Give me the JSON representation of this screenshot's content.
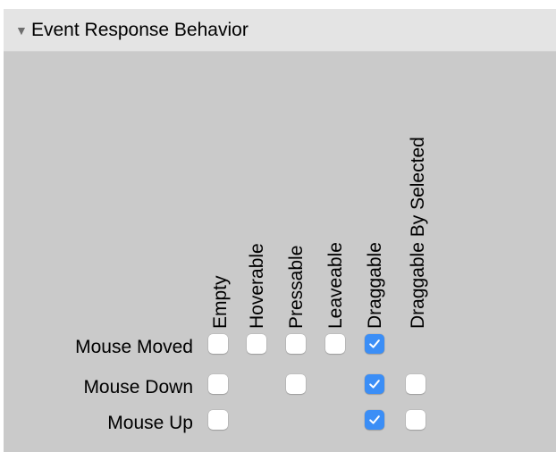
{
  "panel": {
    "disclosure_icon": "▼",
    "title": "Event Response Behavior"
  },
  "columns": [
    {
      "label": "Empty"
    },
    {
      "label": "Hoverable"
    },
    {
      "label": "Pressable"
    },
    {
      "label": "Leaveable"
    },
    {
      "label": "Draggable"
    },
    {
      "label": "Draggable By Selected"
    }
  ],
  "rows": [
    {
      "label": "Mouse Moved",
      "cells": [
        false,
        false,
        false,
        false,
        true,
        null
      ]
    },
    {
      "label": "Mouse Down",
      "cells": [
        false,
        null,
        false,
        null,
        true,
        false
      ]
    },
    {
      "label": "Mouse Up",
      "cells": [
        false,
        null,
        null,
        null,
        true,
        false
      ]
    }
  ],
  "colors": {
    "panel_bg": "#cacaca",
    "header_bg": "#e4e4e4",
    "checkbox_checked": "#3b8ef6",
    "checkbox_unchecked": "#ffffff"
  }
}
